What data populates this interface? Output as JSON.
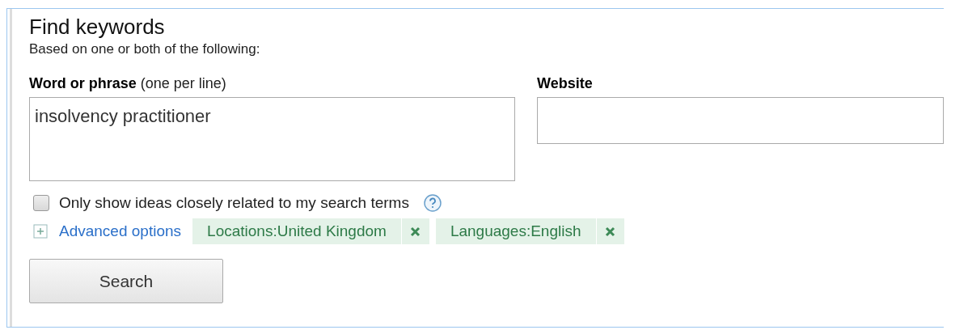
{
  "title": "Find keywords",
  "subtitle": "Based on one or both of the following:",
  "phrase": {
    "label": "**Word or phrase** (one per line)",
    "value": "insolvency practitioner"
  },
  "website": {
    "label": "Website"
  },
  "closely_related": {
    "label": "Only show ideas closely related to my search terms",
    "checked": false
  },
  "advanced": {
    "label": "Advanced options",
    "expanded": false
  },
  "filters": [
    {
      "label": "Locations:United Kingdom"
    },
    {
      "label": "Languages:English"
    }
  ],
  "search_button": "Search"
}
